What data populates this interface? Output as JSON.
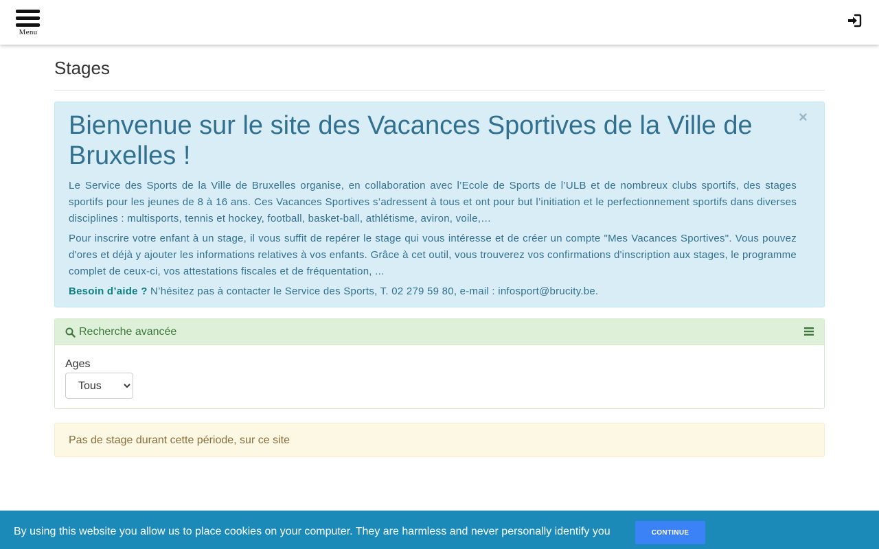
{
  "header": {
    "menu_label": "Menu",
    "login_icon": "sign-in-icon"
  },
  "page": {
    "title": "Stages"
  },
  "welcome": {
    "heading": "Bienvenue sur le site des Vacances Sportives de la Ville de Bruxelles !",
    "paragraph1": "Le Service des Sports de la Ville de Bruxelles organise, en collaboration avec l’Ecole de Sports de l’ULB et de nombreux clubs sportifs, des stages sportifs pour les jeunes de 8 à 16 ans. Ces Vacances Sportives s’adressent à tous et ont pour but l’initiation et le perfectionnement sportifs dans diverses disciplines : multisports, tennis et hockey, football, basket-ball, athlétisme, aviron, voile,…",
    "paragraph2": "Pour inscrire votre enfant à un stage, il vous suffit de repérer le stage qui vous intéresse et de créer un compte \"Mes Vacances Sportives\". Vous pouvez d'ores et déjà y ajouter les informations relatives à vos enfants. Grâce à cet outil, vous trouverez vos confirmations d'inscription aux stages, le programme complet de ceux-ci, vos attestations fiscales et de fréquentation, ...",
    "help_strong": "Besoin d’aide ?",
    "help_text": " N’hésitez pas à contacter le Service des Sports, T. 02 279 59 80, e-mail : infosport@brucity.be.",
    "close": "×"
  },
  "search": {
    "title": "Recherche avancée",
    "ages_label": "Ages",
    "ages_selected": "Tous"
  },
  "notice": {
    "text": "Pas de stage durant cette période, sur ce site"
  },
  "cookie": {
    "text": "By using this website you allow us to place cookies on your computer. They are harmless and never personally identify you",
    "button": "CONTINUE"
  },
  "colors": {
    "info_text": "#31708f",
    "info_bg": "#d9edf7",
    "success_text": "#3c763d",
    "success_bg": "#dff0d8",
    "warning_text": "#8a6d3b",
    "warning_bg": "#fcf8e3",
    "cookie_bg": "#1b8ab8",
    "cookie_button": "#3b82f6",
    "help_strong": "#0f7f82"
  }
}
